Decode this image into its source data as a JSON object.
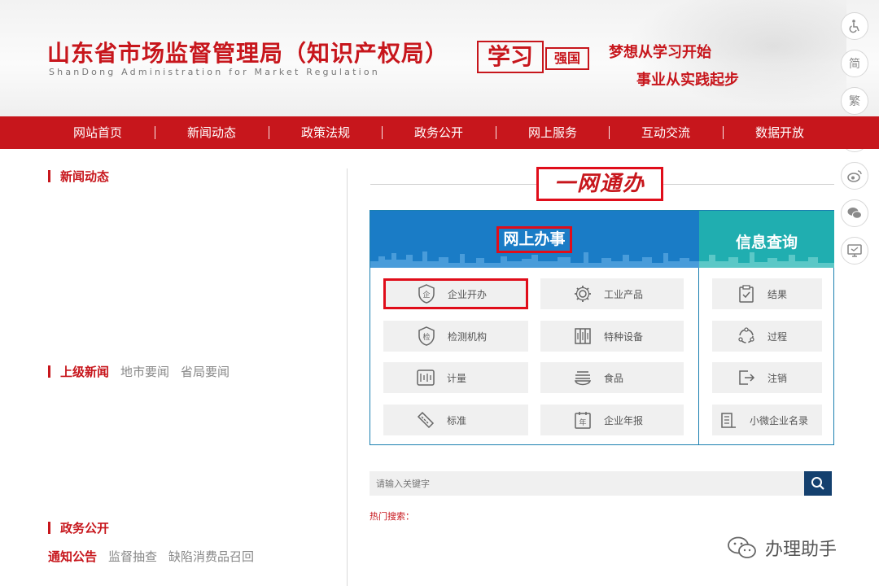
{
  "header": {
    "title": "山东省市场监督管理局（知识产权局）",
    "subtitle": "ShanDong Administration for Market Regulation",
    "badge_main": "学习",
    "badge_sub": "强国",
    "slogan_line1": "梦想从学习开始",
    "slogan_line2": "事业从实践起步"
  },
  "side_tools": {
    "simplified": "简",
    "traditional": "繁"
  },
  "nav": {
    "items": [
      "网站首页",
      "新闻动态",
      "政策法规",
      "政务公开",
      "网上服务",
      "互动交流",
      "数据开放"
    ]
  },
  "left": {
    "news_title": "新闻动态",
    "upper_news": {
      "title": "上级新闻",
      "tabs": [
        "地市要闻",
        "省局要闻"
      ]
    },
    "gov_open": {
      "title": "政务公开",
      "tabs": [
        "通知公告",
        "监督抽查",
        "缺陷消费品召回"
      ]
    }
  },
  "one_network": {
    "title": "一网通办",
    "online_title": "网上办事",
    "query_title": "信息查询",
    "online_items": [
      {
        "label": "企业开办",
        "icon": "enterprise-shield-icon"
      },
      {
        "label": "工业产品",
        "icon": "gear-icon"
      },
      {
        "label": "检测机构",
        "icon": "inspection-shield-icon"
      },
      {
        "label": "特种设备",
        "icon": "special-equipment-icon"
      },
      {
        "label": "计量",
        "icon": "meter-icon"
      },
      {
        "label": "食品",
        "icon": "food-bowl-icon"
      },
      {
        "label": "标准",
        "icon": "ruler-icon"
      },
      {
        "label": "企业年报",
        "icon": "calendar-year-icon"
      }
    ],
    "query_items": [
      {
        "label": "结果",
        "icon": "clipboard-check-icon"
      },
      {
        "label": "过程",
        "icon": "process-cycle-icon"
      },
      {
        "label": "注销",
        "icon": "logout-icon"
      },
      {
        "label": "小微企业名录",
        "icon": "building-list-icon"
      }
    ],
    "year_glyph": "年"
  },
  "search": {
    "placeholder": "请输入关键字",
    "hot_label": "热门搜索："
  },
  "watermark": {
    "text": "办理助手"
  },
  "colors": {
    "brand_red": "#c7161c",
    "highlight_red": "#e00d1a",
    "blue": "#1a7cc6",
    "teal": "#20aeb0",
    "search_btn": "#14406e"
  }
}
